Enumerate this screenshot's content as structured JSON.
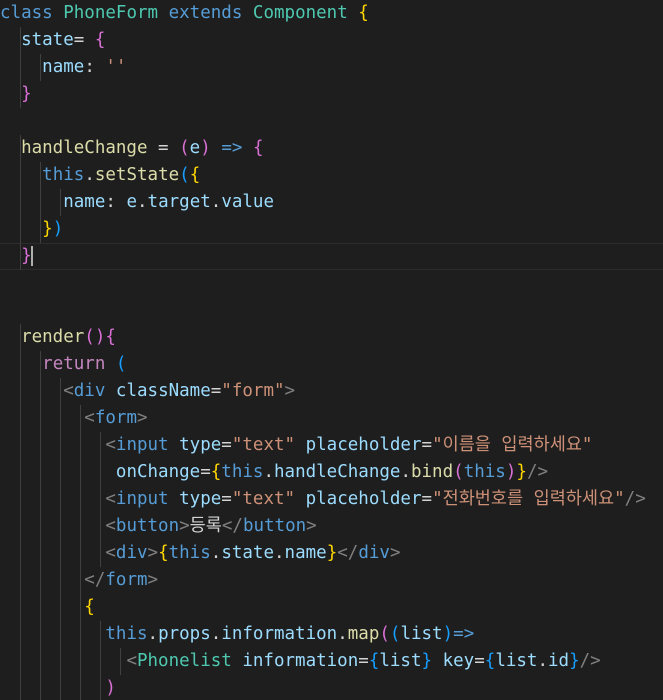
{
  "editor": {
    "lines": [
      "class PhoneForm extends Component {",
      "  state= {",
      "    name: ''",
      "  }",
      "",
      "  handleChange = (e) => {",
      "    this.setState({",
      "      name: e.target.value",
      "    })",
      "  }",
      "",
      "",
      "  render(){",
      "    return (",
      "      <div className=\"form\">",
      "        <form>",
      "          <input type=\"text\" placeholder=\"이름을 입력하세요\"",
      "           onChange={this.handleChange.bind(this)}/>",
      "          <input type=\"text\" placeholder=\"전화번호를 입력하세요\"/>",
      "          <button>등록</button>",
      "          <div>{this.state.name}</div>",
      "        </form>",
      "        {",
      "          this.props.information.map((list)=>",
      "            <Phonelist information={list} key={list.id}/>",
      "          )",
      "        }"
    ],
    "current_line": 10,
    "colors": {
      "background": "#1e1e1e",
      "keyword": "#569cd6",
      "class": "#4ec9b0",
      "function": "#dcdcaa",
      "variable": "#9cdcfe",
      "string": "#ce9178"
    }
  }
}
